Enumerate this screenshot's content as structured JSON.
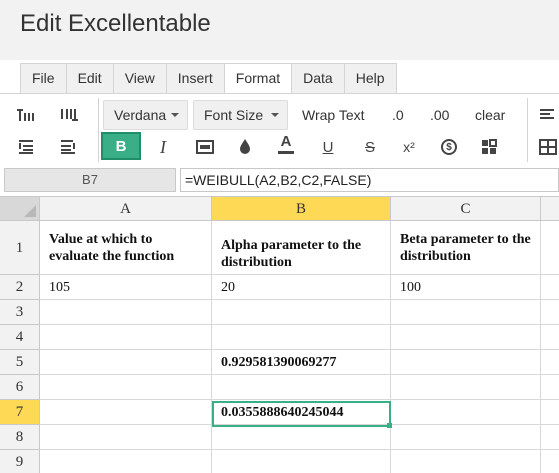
{
  "app": {
    "title": "Edit Excellentable"
  },
  "menu": {
    "items": [
      {
        "label": "File"
      },
      {
        "label": "Edit"
      },
      {
        "label": "View"
      },
      {
        "label": "Insert"
      },
      {
        "label": "Format",
        "active": true
      },
      {
        "label": "Data"
      },
      {
        "label": "Help"
      }
    ]
  },
  "toolbar": {
    "font_family": "Verdana",
    "font_size": "Font Size",
    "wrap_text": "Wrap Text",
    "decrease_decimal": ".0",
    "increase_decimal": ".00",
    "clear": "clear",
    "bold": "B",
    "italic": "I",
    "font_color": "A",
    "underline": "U",
    "strikethrough": "S",
    "superscript": "x²",
    "currency": "$",
    "accent_color": "#3aaf87"
  },
  "formula_bar": {
    "cell_ref": "B7",
    "formula": "=WEIBULL(A2,B2,C2,FALSE)"
  },
  "sheet": {
    "columns": [
      "A",
      "B",
      "C"
    ],
    "selected_column": "B",
    "rows": [
      "1",
      "2",
      "3",
      "4",
      "5",
      "6",
      "7",
      "8",
      "9"
    ],
    "selected_row": "7",
    "cells": {
      "A1": "Value at which to evaluate the function",
      "B1": "Alpha parameter to the distribution",
      "C1": "Beta parameter to the distribution",
      "A2": "105",
      "B2": "20",
      "C2": "100",
      "B5": "0.929581390069277",
      "B7": "0.0355888640245044"
    },
    "selection_color": "#fdd956"
  }
}
